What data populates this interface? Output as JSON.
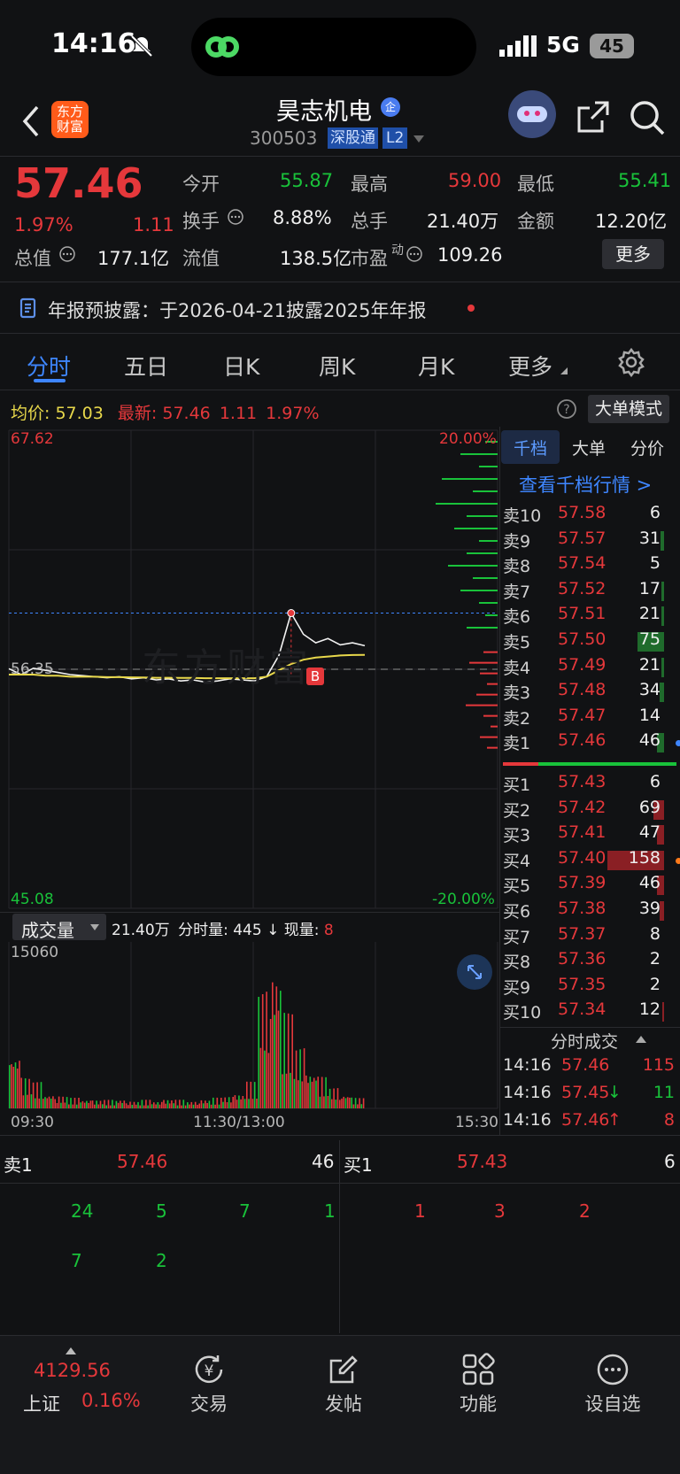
{
  "status_bar": {
    "time": "14:16",
    "network": "5G",
    "battery": "45"
  },
  "header": {
    "logo_text": "东方\n财富",
    "stock_name": "昊志机电",
    "badge_qi": "企",
    "stock_code": "300503",
    "tag_sgt": "深股通",
    "tag_l2": "L2"
  },
  "quote": {
    "price": "57.46",
    "change_pct": "1.97%",
    "change": "1.11",
    "open_label": "今开",
    "open": "55.87",
    "high_label": "最高",
    "high": "59.00",
    "low_label": "最低",
    "low": "55.41",
    "turnover_label": "换手",
    "turnover": "8.88%",
    "volume_label": "总手",
    "volume": "21.40万",
    "amount_label": "金额",
    "amount": "12.20亿",
    "mktcap_label": "总值",
    "mktcap": "177.1亿",
    "float_label": "流值",
    "float": "138.5亿",
    "pe_label": "市盈",
    "pe_sup": "动",
    "pe": "109.26",
    "more_button": "更多"
  },
  "notice": {
    "text": "年报预披露：于2026-04-21披露2025年年报"
  },
  "tabs": [
    "分时",
    "五日",
    "日K",
    "周K",
    "月K",
    "更多"
  ],
  "chart_header": {
    "avg_label": "均价:",
    "avg": "57.03",
    "latest_label": "最新:",
    "latest": "57.46",
    "latest_change": "1.11",
    "latest_pct": "1.97%",
    "big_order_button": "大单模式"
  },
  "chart_labels": {
    "y_top": "67.62",
    "y_bottom": "45.08",
    "pct_top": "20.00%",
    "pct_bottom": "-20.00%",
    "y_mid": "56.35",
    "time_start": "09:30",
    "time_mid": "11:30/13:00",
    "time_end": "15:30",
    "marker_b": "B",
    "watermark": "东方财富"
  },
  "volume_header": {
    "selector": "成交量",
    "total": "21.40万",
    "interval_label": "分时量:",
    "interval": "445",
    "arrow": "↓",
    "now_label": "现量:",
    "now": "8",
    "y_max": "15060"
  },
  "chart_data": {
    "type": "line",
    "title": "",
    "x_range": [
      "09:30",
      "15:30"
    ],
    "ylim": [
      45.08,
      67.62
    ],
    "series": [
      {
        "name": "价格",
        "values": [
          56.38,
          56.1,
          56.4,
          56.3,
          56.2,
          56.1,
          56.05,
          56.0,
          55.95,
          56.0,
          55.9,
          55.95,
          55.85,
          55.9,
          55.8,
          55.85,
          55.75,
          55.8,
          55.9,
          55.85,
          55.8,
          56.0,
          57.0,
          59.0,
          58.0,
          57.6,
          57.8,
          57.5,
          57.6,
          57.46
        ]
      },
      {
        "name": "均价",
        "values": [
          56.1,
          56.1,
          56.1,
          56.05,
          56.05,
          56.0,
          56.0,
          56.0,
          55.98,
          55.98,
          55.97,
          55.96,
          55.95,
          55.95,
          55.94,
          55.94,
          55.93,
          55.93,
          55.93,
          55.93,
          55.93,
          56.0,
          56.3,
          56.6,
          56.8,
          56.9,
          56.95,
          57.0,
          57.02,
          57.03
        ]
      }
    ],
    "volume": [
      6000,
      3000,
      2500,
      1500,
      1200,
      1000,
      900,
      800,
      800,
      900,
      700,
      800,
      700,
      900,
      800,
      700,
      900,
      1000,
      1200,
      1500,
      2500,
      12000,
      15060,
      9000,
      6000,
      4000,
      3000,
      2000,
      1500,
      1000
    ]
  },
  "orderbook": {
    "tabs": [
      "千档",
      "大单",
      "分价"
    ],
    "link": "查看千档行情 >",
    "asks": [
      {
        "label": "卖10",
        "price": "57.58",
        "vol": "6",
        "bar": 0.0
      },
      {
        "label": "卖9",
        "price": "57.57",
        "vol": "31",
        "bar": 0.06
      },
      {
        "label": "卖8",
        "price": "57.54",
        "vol": "5",
        "bar": 0.0
      },
      {
        "label": "卖7",
        "price": "57.52",
        "vol": "17",
        "bar": 0.04
      },
      {
        "label": "卖6",
        "price": "57.51",
        "vol": "21",
        "bar": 0.05
      },
      {
        "label": "卖5",
        "price": "57.50",
        "vol": "75",
        "bar": 0.47
      },
      {
        "label": "卖4",
        "price": "57.49",
        "vol": "21",
        "bar": 0.05
      },
      {
        "label": "卖3",
        "price": "57.48",
        "vol": "34",
        "bar": 0.08
      },
      {
        "label": "卖2",
        "price": "57.47",
        "vol": "14",
        "bar": 0.0
      },
      {
        "label": "卖1",
        "price": "57.46",
        "vol": "46",
        "bar": 0.12
      }
    ],
    "bids": [
      {
        "label": "买1",
        "price": "57.43",
        "vol": "6",
        "bar": 0.0
      },
      {
        "label": "买2",
        "price": "57.42",
        "vol": "69",
        "bar": 0.18
      },
      {
        "label": "买3",
        "price": "57.41",
        "vol": "47",
        "bar": 0.12
      },
      {
        "label": "买4",
        "price": "57.40",
        "vol": "158",
        "bar": 1.0
      },
      {
        "label": "买5",
        "price": "57.39",
        "vol": "46",
        "bar": 0.12
      },
      {
        "label": "买6",
        "price": "57.38",
        "vol": "39",
        "bar": 0.08
      },
      {
        "label": "买7",
        "price": "57.37",
        "vol": "8",
        "bar": 0.0
      },
      {
        "label": "买8",
        "price": "57.36",
        "vol": "2",
        "bar": 0.0
      },
      {
        "label": "买9",
        "price": "57.35",
        "vol": "2",
        "bar": 0.0
      },
      {
        "label": "买10",
        "price": "57.34",
        "vol": "12",
        "bar": 0.03
      }
    ],
    "trades_title": "分时成交",
    "trades": [
      {
        "time": "14:16",
        "price": "57.46",
        "vol": "115",
        "dir": ""
      },
      {
        "time": "14:16",
        "price": "57.45",
        "vol": "11",
        "dir": "↓"
      },
      {
        "time": "14:16",
        "price": "57.46",
        "vol": "8",
        "dir": "↑"
      }
    ]
  },
  "queue": {
    "sell_label": "卖1",
    "sell_price": "57.46",
    "sell_vol": "46",
    "buy_label": "买1",
    "buy_price": "57.43",
    "buy_vol": "6",
    "sell_orders": [
      "24",
      "5",
      "7",
      "1",
      "7",
      "2"
    ],
    "buy_orders": [
      "1",
      "3",
      "2"
    ]
  },
  "bottom_nav": {
    "index_value": "4129.56",
    "index_name": "上证",
    "index_pct": "0.16%",
    "items": [
      "交易",
      "发帖",
      "功能",
      "设自选"
    ]
  }
}
